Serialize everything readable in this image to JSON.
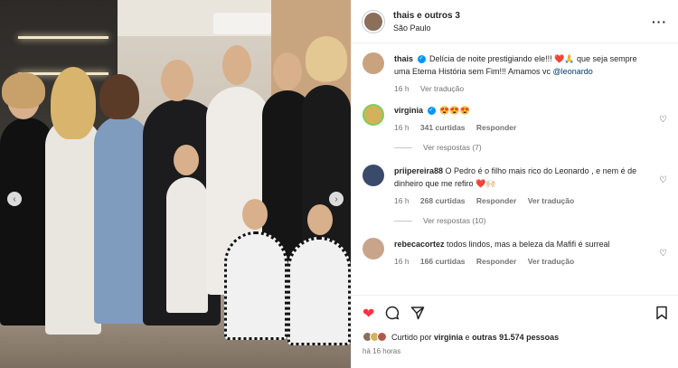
{
  "header": {
    "username": "thais e outros 3",
    "location": "São Paulo",
    "more_icon": "more-dots-icon"
  },
  "comments": [
    {
      "username": "thais",
      "verified": true,
      "text": "Delícia de noite prestigiando ele!!! ❤️🙏 que seja sempre uma Eterna História sem Fim!!! Amamos vc ",
      "mention": "@leonardo",
      "time": "16 h",
      "likes": "",
      "reply": "",
      "translate": "Ver tradução",
      "has_heart": false,
      "avatar_color": "#c9a27e"
    },
    {
      "username": "virginia",
      "verified": true,
      "text": "😍😍😍",
      "mention": "",
      "time": "16 h",
      "likes": "341 curtidas",
      "reply": "Responder",
      "translate": "",
      "has_heart": true,
      "avatar_color": "#d4b15a",
      "replies": "Ver respostas (7)"
    },
    {
      "username": "priipereira88",
      "verified": false,
      "text": "O Pedro é o filho mais rico do Leonardo , e nem é de dinheiro que me refiro ❤️🙌🏻",
      "mention": "",
      "time": "16 h",
      "likes": "268 curtidas",
      "reply": "Responder",
      "translate": "Ver tradução",
      "has_heart": true,
      "avatar_color": "#3a4a6b",
      "replies": "Ver respostas (10)"
    },
    {
      "username": "rebecacortez",
      "verified": false,
      "text": "todos lindos, mas a beleza da Mafifi é surreal",
      "mention": "",
      "time": "16 h",
      "likes": "166 curtidas",
      "reply": "Responder",
      "translate": "Ver tradução",
      "has_heart": true,
      "avatar_color": "#c8a48a"
    }
  ],
  "actions": {
    "like_icon": "heart-filled-icon",
    "comment_icon": "comment-icon",
    "share_icon": "share-icon",
    "save_icon": "bookmark-icon",
    "like_color": "#ff3040"
  },
  "likes_summary": {
    "prefix": "Curtido por ",
    "user": "virginia",
    "middle": " e ",
    "others": "outras 91.574 pessoas"
  },
  "time_ago": "há 16 horas",
  "photo": {
    "nav_left_icon": "chevron-left-icon",
    "nav_right_icon": "chevron-right-icon"
  }
}
